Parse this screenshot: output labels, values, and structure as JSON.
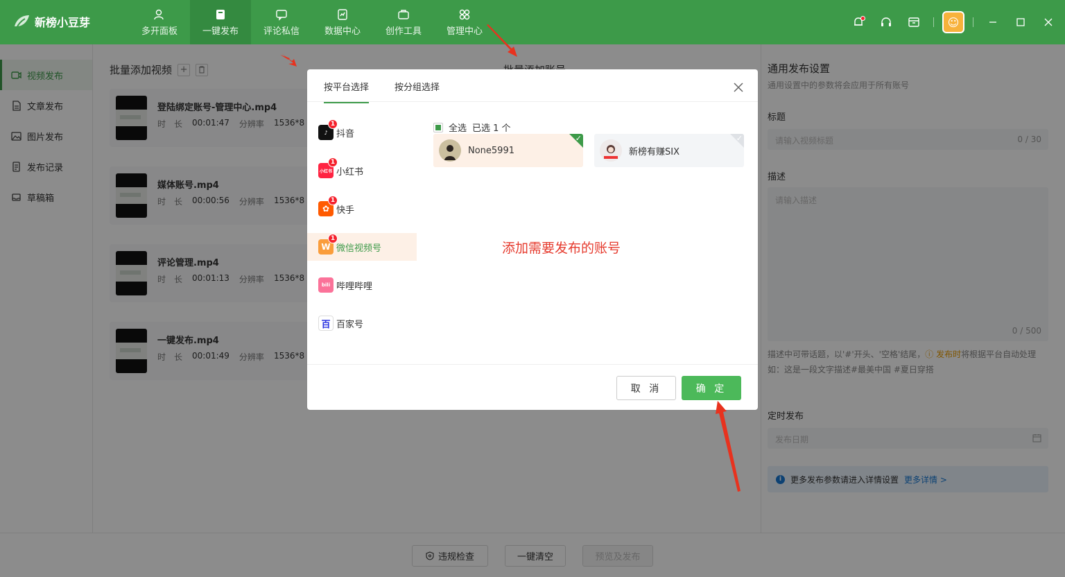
{
  "app": {
    "title": "新榜小豆芽"
  },
  "nav": {
    "items": [
      {
        "label": "多开面板",
        "icon": "user-icon"
      },
      {
        "label": "一键发布",
        "icon": "publish-icon",
        "active": true
      },
      {
        "label": "评论私信",
        "icon": "comment-icon"
      },
      {
        "label": "数据中心",
        "icon": "chart-icon"
      },
      {
        "label": "创作工具",
        "icon": "briefcase-icon"
      },
      {
        "label": "管理中心",
        "icon": "grid-icon"
      }
    ]
  },
  "sidebar": {
    "items": [
      {
        "label": "视频发布",
        "icon": "video-icon",
        "active": true
      },
      {
        "label": "文章发布",
        "icon": "article-icon"
      },
      {
        "label": "图片发布",
        "icon": "image-icon"
      },
      {
        "label": "发布记录",
        "icon": "record-icon"
      },
      {
        "label": "草稿箱",
        "icon": "draft-icon"
      }
    ]
  },
  "main": {
    "videos_title": "批量添加视频",
    "accounts_title": "批量添加账号",
    "videos": [
      {
        "name": "登陆绑定账号-管理中心.mp4",
        "duration_label": "时　长",
        "duration": "00:01:47",
        "res_label": "分辨率",
        "resolution": "1536*8"
      },
      {
        "name": "媒体账号.mp4",
        "duration_label": "时　长",
        "duration": "00:00:56",
        "res_label": "分辨率",
        "resolution": "1536*8"
      },
      {
        "name": "评论管理.mp4",
        "duration_label": "时　长",
        "duration": "00:01:13",
        "res_label": "分辨率",
        "resolution": "1536*8"
      },
      {
        "name": "一键发布.mp4",
        "duration_label": "时　长",
        "duration": "00:01:49",
        "res_label": "分辨率",
        "resolution": "1536*8"
      }
    ]
  },
  "settings": {
    "title": "通用发布设置",
    "subtitle": "通用设置中的参数将会应用于所有账号",
    "title_label": "标题",
    "title_placeholder": "请输入视频标题",
    "title_count": "0 / 30",
    "desc_label": "描述",
    "desc_placeholder": "请输入描述",
    "desc_count": "0 / 500",
    "hint_text1": "描述中可带话题，以'#'开头、'空格'结尾，",
    "hint_warn": "ⓘ 发布时",
    "hint_text2": "将根据平台自动处理",
    "hint_example": "如：这是一段文字描述#最美中国 #夏日穿搭",
    "schedule_label": "定时发布",
    "schedule_placeholder": "发布日期",
    "info_text": "更多发布参数请进入详情设置",
    "info_link": "更多详情 >"
  },
  "footer": {
    "check_label": "违规检查",
    "clear_label": "一键清空",
    "preview_label": "预览及发布"
  },
  "modal": {
    "tabs": [
      "按平台选择",
      "按分组选择"
    ],
    "platforms": [
      {
        "label": "抖音",
        "badge": "1",
        "color": "#111111",
        "logo": "♪"
      },
      {
        "label": "小红书",
        "badge": "1",
        "color": "#ff2442",
        "logo": "小红书"
      },
      {
        "label": "快手",
        "badge": "1",
        "color": "#ff5a00",
        "logo": "✿"
      },
      {
        "label": "微信视频号",
        "badge": "1",
        "color": "#fa9d3b",
        "logo": "W",
        "active": true
      },
      {
        "label": "哔哩哔哩",
        "badge": "",
        "color": "#fb7299",
        "logo": "bili"
      },
      {
        "label": "百家号",
        "badge": "",
        "color": "#2932e1",
        "logo": "百"
      }
    ],
    "select_all": "全选",
    "selected_text": "已选 1 个",
    "accounts": [
      {
        "name": "None5991",
        "selected": true
      },
      {
        "name": "新榜有赚SIX",
        "selected": false
      }
    ],
    "annotation": "添加需要发布的账号",
    "cancel_label": "取 消",
    "ok_label": "确 定"
  },
  "colors": {
    "brand": "#3d9a49",
    "annotation": "#e63b2e"
  }
}
